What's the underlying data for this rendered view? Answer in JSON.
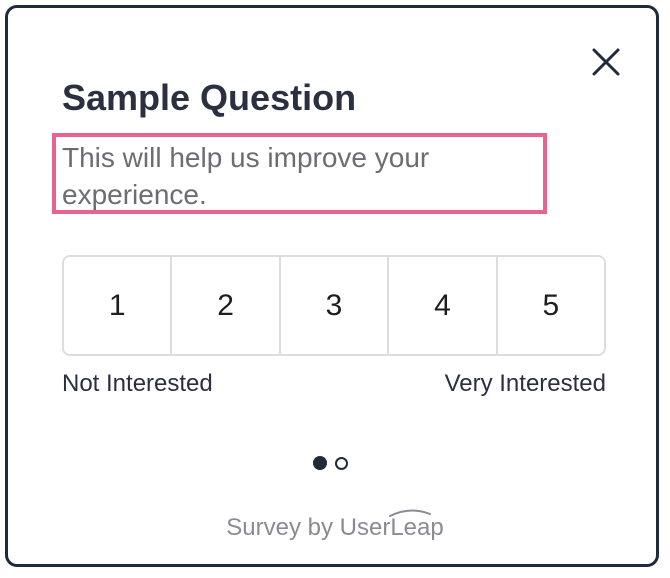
{
  "question": {
    "title": "Sample Question",
    "subtitle": "This will help us improve your experience."
  },
  "scale": {
    "options": [
      "1",
      "2",
      "3",
      "4",
      "5"
    ],
    "low_label": "Not Interested",
    "high_label": "Very Interested"
  },
  "pagination": {
    "current_page": 1,
    "total_pages": 2
  },
  "footer": {
    "prefix": "Survey by ",
    "brand": "UserLeap"
  },
  "colors": {
    "border": "#1f2b3a",
    "highlight": "#e7648f",
    "text_primary": "#2b3040",
    "text_secondary": "#6b6d72",
    "footer_text": "#8a8c94"
  },
  "icons": {
    "close": "close-icon"
  }
}
